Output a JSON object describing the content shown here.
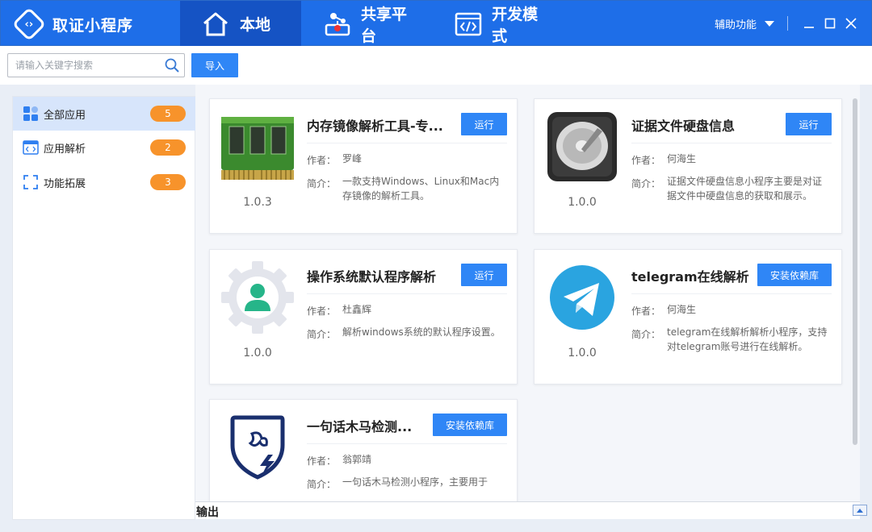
{
  "app": {
    "title": "取证小程序"
  },
  "nav": {
    "tabs": [
      {
        "label": "本地",
        "icon": "home-icon",
        "active": true
      },
      {
        "label": "共享平台",
        "icon": "share-network-icon",
        "active": false
      },
      {
        "label": "开发模式",
        "icon": "code-window-icon",
        "active": false
      }
    ]
  },
  "window": {
    "assist_label": "辅助功能"
  },
  "search": {
    "placeholder": "请输入关键字搜索",
    "value": ""
  },
  "toolbar": {
    "import_label": "导入"
  },
  "sidebar": {
    "items": [
      {
        "label": "全部应用",
        "count": "5",
        "icon": "grid-apps-icon",
        "active": true
      },
      {
        "label": "应用解析",
        "count": "2",
        "icon": "code-window-icon",
        "active": false
      },
      {
        "label": "功能拓展",
        "count": "3",
        "icon": "expand-frame-icon",
        "active": false
      }
    ]
  },
  "labels": {
    "author": "作者：",
    "intro": "简介：",
    "output": "输出"
  },
  "apps": [
    {
      "name": "内存镜像解析工具-专...",
      "version": "1.0.3",
      "author": "罗峰",
      "intro": "一款支持Windows、Linux和Mac内存镜像的解析工具。",
      "button": "运行",
      "icon": "memory-chip-icon"
    },
    {
      "name": "证据文件硬盘信息",
      "version": "1.0.0",
      "author": "何海生",
      "intro": "证据文件硬盘信息小程序主要是对证据文件中硬盘信息的获取和展示。",
      "button": "运行",
      "icon": "hard-disk-icon"
    },
    {
      "name": "操作系统默认程序解析",
      "version": "1.0.0",
      "author": "杜鑫辉",
      "intro": "解析windows系统的默认程序设置。",
      "button": "运行",
      "icon": "gear-user-icon"
    },
    {
      "name": "telegram在线解析",
      "version": "1.0.0",
      "author": "何海生",
      "intro": "telegram在线解析解析小程序，支持对telegram账号进行在线解析。",
      "button": "安装依赖库",
      "icon": "telegram-icon"
    },
    {
      "name": "一句话木马检测...",
      "version": "",
      "author": "翁郭靖",
      "intro": "一句话木马检测小程序，主要用于",
      "button": "安装依赖库",
      "icon": "shield-bolt-icon"
    }
  ]
}
